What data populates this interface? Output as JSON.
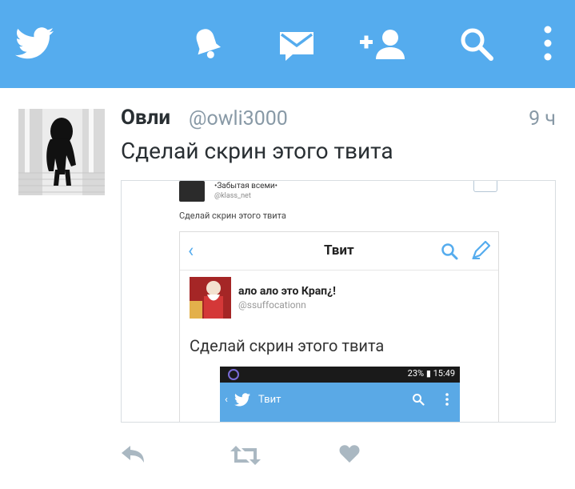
{
  "colors": {
    "brand": "#55acee",
    "text": "#292f33",
    "muted": "#8899a6",
    "action": "#aab8c2"
  },
  "header": {
    "icons": [
      "twitter-bird-icon",
      "bell-icon",
      "envelope-icon",
      "add-user-icon",
      "search-icon",
      "more-vertical-icon"
    ]
  },
  "tweet": {
    "name": "Овли",
    "handle": "@owli3000",
    "time": "9 ч",
    "text": "Сделай скрин этого твита",
    "actions": [
      "reply-icon",
      "retweet-icon",
      "like-heart-icon"
    ]
  },
  "photo": {
    "forgotten_name": "•Забытая всеми•",
    "forgotten_handle": "@klass_net",
    "caption": "Сделай скрин этого твита",
    "screen_title": "Твит",
    "user_name": "ало ало это Крап¿!",
    "user_handle": "@ssuffocationn",
    "tweet_text": "Сделай скрин этого твита",
    "status_bar": "23% ▮ 15:49",
    "inner_title": "Твит"
  }
}
